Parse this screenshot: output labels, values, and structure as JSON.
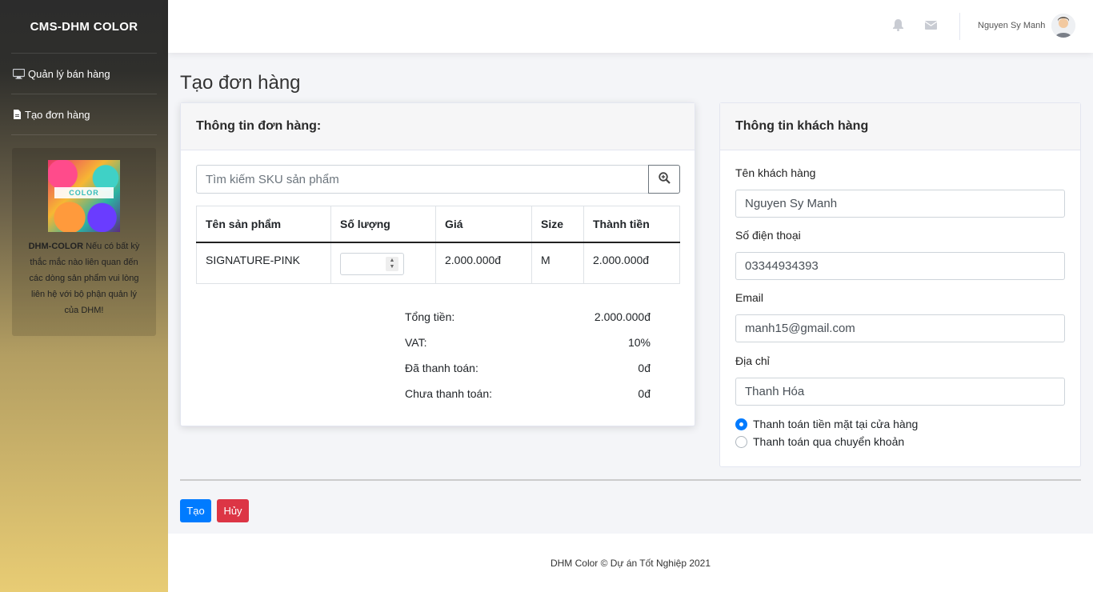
{
  "sidebar": {
    "brand": "CMS-DHM COLOR",
    "items": [
      {
        "label": "Quản lý bán hàng",
        "icon": "monitor-icon"
      },
      {
        "label": "Tạo đơn hàng",
        "icon": "file-icon"
      }
    ],
    "promo": {
      "logo_text": "COLOR",
      "brand_bold": "DHM-COLOR",
      "text": "Nếu có bất kỳ thắc mắc nào liên quan đến các dòng sản phẩm vui lòng liên hệ với bộ phận quản lý của DHM!"
    }
  },
  "topbar": {
    "username": "Nguyen Sy Manh",
    "icons": [
      "bell-icon",
      "envelope-icon",
      "avatar"
    ]
  },
  "page": {
    "title": "Tạo đơn hàng"
  },
  "order": {
    "header": "Thông tin đơn hàng:",
    "search_placeholder": "Tìm kiếm SKU sản phẩm",
    "columns": [
      "Tên sản phẩm",
      "Số lượng",
      "Giá",
      "Size",
      "Thành tiền"
    ],
    "rows": [
      {
        "name": "SIGNATURE-PINK",
        "quantity": "",
        "price": "2.000.000đ",
        "size": "M",
        "total": "2.000.000đ"
      }
    ],
    "summary": {
      "total_label": "Tổng tiền:",
      "total_value": "2.000.000đ",
      "vat_label": "VAT:",
      "vat_value": "10%",
      "paid_label": "Đã thanh toán:",
      "paid_value": "0đ",
      "unpaid_label": "Chưa thanh toán:",
      "unpaid_value": "0đ"
    }
  },
  "customer": {
    "header": "Thông tin khách hàng",
    "name_label": "Tên khách hàng",
    "name_value": "Nguyen Sy Manh",
    "phone_label": "Số điện thoại",
    "phone_value": "03344934393",
    "email_label": "Email",
    "email_value": "manh15@gmail.com",
    "address_label": "Địa chỉ",
    "address_value": "Thanh Hóa",
    "payment_options": [
      {
        "label": "Thanh toán tiền mặt tại cửa hàng",
        "checked": true
      },
      {
        "label": "Thanh toán qua chuyển khoản",
        "checked": false
      }
    ]
  },
  "actions": {
    "create_label": "Tạo",
    "cancel_label": "Hủy"
  },
  "footer": {
    "text": "DHM Color © Dự án Tốt Nghiệp 2021"
  },
  "colors": {
    "primary": "#007bff",
    "danger": "#dc3545",
    "sidebar_top": "#2c2c2c",
    "sidebar_bottom": "#e8cc74"
  }
}
